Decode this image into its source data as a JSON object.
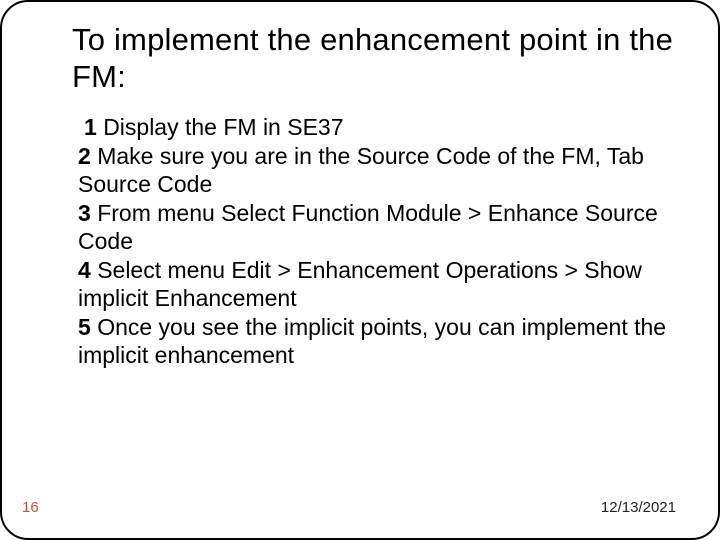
{
  "title": "To implement the enhancement point in the FM:",
  "steps": [
    {
      "n": "1",
      "t": "Display the FM in SE37"
    },
    {
      "n": "2",
      "t": "Make sure you are in the Source Code of the FM, Tab Source Code"
    },
    {
      "n": "3",
      "t": "From menu Select Function Module > Enhance Source Code"
    },
    {
      "n": "4",
      "t": "Select menu Edit > Enhancement Operations > Show implicit Enhancement"
    },
    {
      "n": "5",
      "t": "Once you see the implicit points, you can implement the implicit enhancement"
    }
  ],
  "page_number": "16",
  "date": "12/13/2021"
}
